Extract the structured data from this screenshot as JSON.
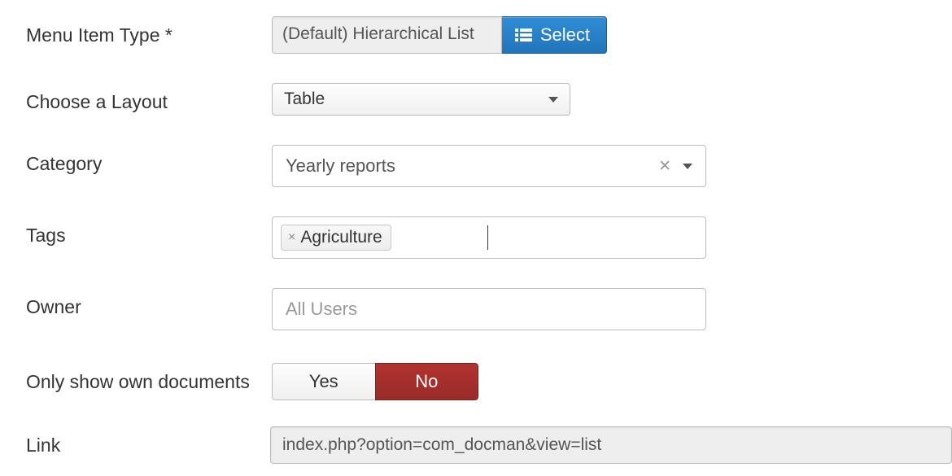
{
  "menuItemType": {
    "label": "Menu Item Type *",
    "value": "(Default) Hierarchical List",
    "selectButton": "Select"
  },
  "layout": {
    "label": "Choose a Layout",
    "value": "Table"
  },
  "category": {
    "label": "Category",
    "value": "Yearly reports"
  },
  "tags": {
    "label": "Tags",
    "items": [
      "Agriculture"
    ]
  },
  "owner": {
    "label": "Owner",
    "placeholder": "All Users"
  },
  "onlyOwn": {
    "label": "Only show own documents",
    "yes": "Yes",
    "no": "No",
    "selected": "No"
  },
  "link": {
    "label": "Link",
    "value": "index.php?option=com_docman&view=list"
  }
}
